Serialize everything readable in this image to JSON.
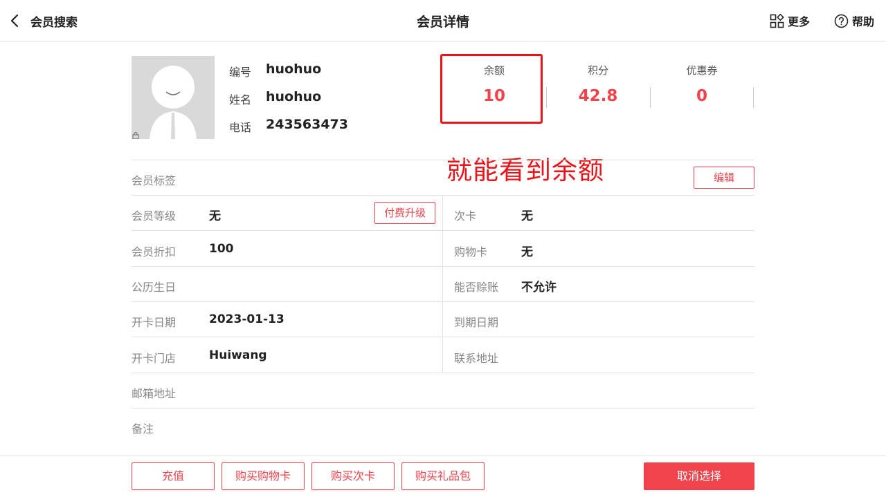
{
  "header": {
    "back_label": "会员搜索",
    "title": "会员详情",
    "more_label": "更多",
    "help_label": "帮助"
  },
  "profile": {
    "id_label": "编号",
    "id_value": "huohuo",
    "name_label": "姓名",
    "name_value": "huohuo",
    "phone_label": "电话",
    "phone_value": "243563473"
  },
  "stats": {
    "balance_label": "余额",
    "balance_value": "10",
    "points_label": "积分",
    "points_value": "42.8",
    "coupons_label": "优惠券",
    "coupons_value": "0"
  },
  "annotation": "就能看到余额",
  "tags": {
    "label": "会员标签",
    "edit_label": "编辑"
  },
  "rows": {
    "level_label": "会员等级",
    "level_value": "无",
    "upgrade_label": "付费升级",
    "times_card_label": "次卡",
    "times_card_value": "无",
    "discount_label": "会员折扣",
    "discount_value": "100",
    "shopping_card_label": "购物卡",
    "shopping_card_value": "无",
    "birthday_label": "公历生日",
    "credit_label": "能否赊账",
    "credit_value": "不允许",
    "open_date_label": "开卡日期",
    "open_date_value": "2023-01-13",
    "expire_label": "到期日期",
    "open_store_label": "开卡门店",
    "open_store_value": "Huiwang",
    "address_label": "联系地址",
    "email_label": "邮箱地址",
    "remark_label": "备注"
  },
  "footer": {
    "recharge_label": "充值",
    "buy_shopping_card_label": "购买购物卡",
    "buy_times_card_label": "购买次卡",
    "buy_gift_label": "购买礼品包",
    "cancel_label": "取消选择"
  },
  "colors": {
    "accent": "#f0434b",
    "annotation": "#e8141a"
  }
}
